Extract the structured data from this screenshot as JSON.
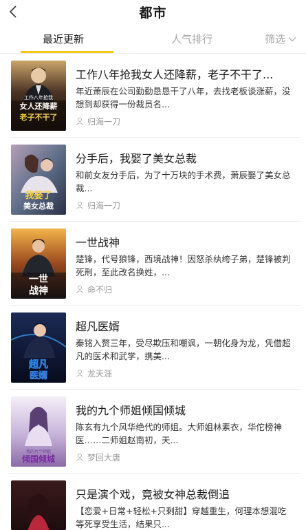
{
  "header": {
    "title": "都市",
    "back_icon": "chevron-left-icon"
  },
  "tabs": {
    "recent": "最近更新",
    "popular": "人气排行",
    "filter": "筛选",
    "accent": "#f5c518"
  },
  "books": [
    {
      "title": "工作八年抢我女人还降薪，老子不干了...",
      "desc": "年近萧辰在公司勤勤恳恳干了八年，去找老板谈涨薪，没想到却获得一份裁员名...",
      "author": "归海一刀",
      "cover_text": "女人还降薪",
      "cover_subtext": "老子不干了",
      "cover_top": "工作八年抢我"
    },
    {
      "title": "分手后，我娶了美女总裁",
      "desc": "和前女友分手后，为了十万块的手术费，萧辰娶了美女总裁...",
      "author": "归海一刀",
      "cover_text": "我娶了",
      "cover_subtext": "美女总裁"
    },
    {
      "title": "一世战神",
      "desc": "楚锋，代号狼锋，西境战神！因怒杀纨绔子弟，楚锋被判死刑，至此改名换姓，...",
      "author": "命不归",
      "cover_text": "一世",
      "cover_subtext": "战神"
    },
    {
      "title": "超凡医婿",
      "desc": "秦铭入赘三年，受尽欺压和嘲讽，一朝化身为龙，凭借超凡的医术和武学，携美...",
      "author": "龙天涯",
      "cover_text": "超凡",
      "cover_subtext": "医婿"
    },
    {
      "title": "我的九个师姐倾国倾城",
      "desc": "陈玄有九个风华绝代的师姐。大师姐林素衣，华佗榜神医……二师姐赵南初，天...",
      "author": "梦回大唐",
      "cover_text": "倾国倾城",
      "cover_subtext": "我的九个师姐"
    },
    {
      "title": "只是演个戏，竟被女神总裁倒追",
      "desc": "【恋爱+日常+轻松+只剩甜】穿越重生，何理本想混吃等死享受生活，结果只...",
      "author": "",
      "cover_text": "",
      "cover_subtext": ""
    }
  ]
}
